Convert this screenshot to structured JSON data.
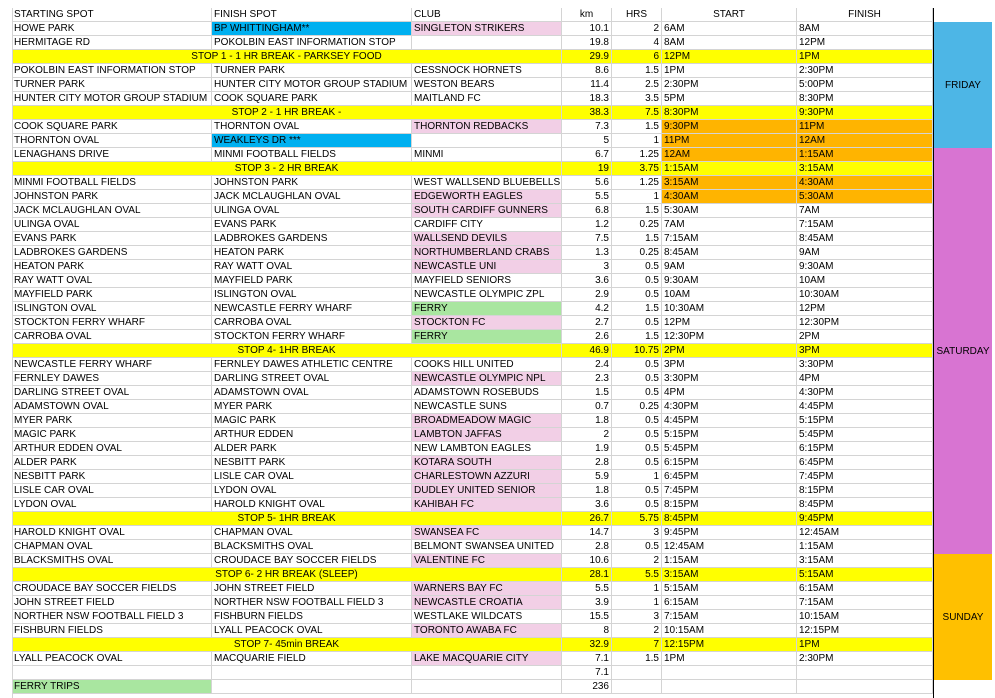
{
  "colors": {
    "yellow": "#ffff00",
    "pink": "#f2cfe6",
    "blue": "#00b0f0",
    "green": "#a9e6a0",
    "orange": "#ffb400",
    "friday": "#4db6e6",
    "saturday": "#d874d2",
    "sunday": "#ffc000"
  },
  "headers": [
    "STARTING SPOT",
    "FINISH SPOT",
    "CLUB",
    "km",
    "HRS",
    "START",
    "FINISH"
  ],
  "rows": [
    {
      "a": "HOWE PARK",
      "b": "BP WHITTINGHAM**",
      "c": "SINGLETON STRIKERS",
      "d": "10.1",
      "e": "2",
      "f": "6AM",
      "g": "8AM",
      "bc": "blue",
      "cc": "pink"
    },
    {
      "a": "HERMITAGE RD",
      "b": "POKOLBIN EAST INFORMATION STOP",
      "c": "",
      "d": "19.8",
      "e": "4",
      "f": "8AM",
      "g": "12PM"
    },
    {
      "stop": "STOP 1 - 1 HR BREAK - PARKSEY FOOD",
      "d": "29.9",
      "e": "6",
      "f": "12PM",
      "g": "1PM"
    },
    {
      "a": "POKOLBIN EAST INFORMATION STOP",
      "b": "TURNER PARK",
      "c": "CESSNOCK HORNETS",
      "d": "8.6",
      "e": "1.5",
      "f": "1PM",
      "g": "2:30PM"
    },
    {
      "a": "TURNER PARK",
      "b": "HUNTER CITY MOTOR GROUP STADIUM",
      "c": "WESTON BEARS",
      "d": "11.4",
      "e": "2.5",
      "f": "2:30PM",
      "g": "5:00PM"
    },
    {
      "a": "HUNTER CITY MOTOR GROUP STADIUM",
      "b": "COOK SQUARE PARK",
      "c": "MAITLAND FC",
      "d": "18.3",
      "e": "3.5",
      "f": "5PM",
      "g": "8:30PM"
    },
    {
      "stop": "STOP 2 - 1 HR BREAK -",
      "d": "38.3",
      "e": "7.5",
      "f": "8:30PM",
      "g": "9:30PM"
    },
    {
      "a": "COOK SQUARE PARK",
      "b": "THORNTON OVAL",
      "c": "THORNTON REDBACKS",
      "d": "7.3",
      "e": "1.5",
      "f": "9:30PM",
      "g": "11PM",
      "cc": "pink",
      "fc": "orange",
      "gc": "orange"
    },
    {
      "a": "THORNTON OVAL",
      "b": "WEAKLEYS DR ***",
      "c": "",
      "d": "5",
      "e": "1",
      "f": "11PM",
      "g": "12AM",
      "bc": "blue",
      "fc": "orange",
      "gc": "orange"
    },
    {
      "a": "LENAGHANS DRIVE",
      "b": "MINMI FOOTBALL FIELDS",
      "c": "MINMI",
      "d": "6.7",
      "e": "1.25",
      "f": "12AM",
      "g": "1:15AM",
      "fc": "orange",
      "gc": "orange"
    },
    {
      "stop": "STOP 3 - 2 HR BREAK",
      "d": "19",
      "e": "3.75",
      "f": "1:15AM",
      "g": "3:15AM"
    },
    {
      "a": "MINMI FOOTBALL FIELDS",
      "b": "JOHNSTON PARK",
      "c": "WEST WALLSEND BLUEBELLS",
      "d": "5.6",
      "e": "1.25",
      "f": "3:15AM",
      "g": "4:30AM",
      "fc": "orange",
      "gc": "orange"
    },
    {
      "a": "JOHNSTON PARK",
      "b": "JACK MCLAUGHLAN OVAL",
      "c": "EDGEWORTH EAGLES",
      "d": "5.5",
      "e": "1",
      "f": "4:30AM",
      "g": "5:30AM",
      "cc": "pink",
      "fc": "orange",
      "gc": "orange"
    },
    {
      "a": "JACK MCLAUGHLAN OVAL",
      "b": "ULINGA OVAL",
      "c": "SOUTH CARDIFF GUNNERS",
      "d": "6.8",
      "e": "1.5",
      "f": "5:30AM",
      "g": "7AM",
      "cc": "pink"
    },
    {
      "a": "ULINGA OVAL",
      "b": "EVANS PARK",
      "c": "CARDIFF CITY",
      "d": "1.2",
      "e": "0.25",
      "f": "7AM",
      "g": "7:15AM"
    },
    {
      "a": "EVANS PARK",
      "b": "LADBROKES GARDENS",
      "c": "WALLSEND DEVILS",
      "d": "7.5",
      "e": "1.5",
      "f": "7:15AM",
      "g": "8:45AM",
      "cc": "pink"
    },
    {
      "a": "LADBROKES GARDENS",
      "b": "HEATON PARK",
      "c": "NORTHUMBERLAND CRABS",
      "d": "1.3",
      "e": "0.25",
      "f": "8:45AM",
      "g": "9AM",
      "cc": "pink"
    },
    {
      "a": "HEATON PARK",
      "b": "RAY WATT OVAL",
      "c": "NEWCASTLE UNI",
      "d": "3",
      "e": "0.5",
      "f": "9AM",
      "g": "9:30AM",
      "cc": "pink"
    },
    {
      "a": "RAY WATT OVAL",
      "b": "MAYFIELD PARK",
      "c": "MAYFIELD SENIORS",
      "d": "3.6",
      "e": "0.5",
      "f": "9:30AM",
      "g": "10AM"
    },
    {
      "a": "MAYFIELD PARK",
      "b": "ISLINGTON OVAL",
      "c": "NEWCASTLE OLYMPIC ZPL",
      "d": "2.9",
      "e": "0.5",
      "f": "10AM",
      "g": "10:30AM"
    },
    {
      "a": "ISLINGTON OVAL",
      "b": "NEWCASTLE FERRY WHARF",
      "c": "FERRY",
      "d": "4.2",
      "e": "1.5",
      "f": "10:30AM",
      "g": "12PM",
      "cc": "green"
    },
    {
      "a": "STOCKTON FERRY WHARF",
      "b": "CARROBA OVAL",
      "c": "STOCKTON FC",
      "d": "2.7",
      "e": "0.5",
      "f": "12PM",
      "g": "12:30PM",
      "cc": "pink"
    },
    {
      "a": "CARROBA OVAL",
      "b": "STOCKTON FERRY WHARF",
      "c": "FERRY",
      "d": "2.6",
      "e": "1.5",
      "f": "12:30PM",
      "g": "2PM",
      "cc": "green"
    },
    {
      "stop": "STOP 4- 1HR BREAK",
      "d": "46.9",
      "e": "10.75",
      "f": "2PM",
      "g": "3PM"
    },
    {
      "a": "NEWCASTLE FERRY WHARF",
      "b": "FERNLEY DAWES ATHLETIC CENTRE",
      "c": "COOKS HILL UNITED",
      "d": "2.4",
      "e": "0.5",
      "f": "3PM",
      "g": "3:30PM"
    },
    {
      "a": "FERNLEY DAWES",
      "b": "DARLING STREET OVAL",
      "c": "NEWCASTLE OLYMPIC NPL",
      "d": "2.3",
      "e": "0.5",
      "f": "3:30PM",
      "g": "4PM",
      "cc": "pink"
    },
    {
      "a": "DARLING STREET OVAL",
      "b": "ADAMSTOWN OVAL",
      "c": "ADAMSTOWN ROSEBUDS",
      "d": "1.5",
      "e": "0.5",
      "f": "4PM",
      "g": "4:30PM"
    },
    {
      "a": "ADAMSTOWN OVAL",
      "b": "MYER PARK",
      "c": "NEWCASTLE SUNS",
      "d": "0.7",
      "e": "0.25",
      "f": "4:30PM",
      "g": "4:45PM"
    },
    {
      "a": "MYER PARK",
      "b": "MAGIC PARK",
      "c": "BROADMEADOW MAGIC",
      "d": "1.8",
      "e": "0.5",
      "f": "4:45PM",
      "g": "5:15PM",
      "cc": "pink"
    },
    {
      "a": "MAGIC PARK",
      "b": "ARTHUR EDDEN",
      "c": "LAMBTON JAFFAS",
      "d": "2",
      "e": "0.5",
      "f": "5:15PM",
      "g": "5:45PM",
      "cc": "pink"
    },
    {
      "a": "ARTHUR EDDEN OVAL",
      "b": "ALDER PARK",
      "c": "NEW LAMBTON EAGLES",
      "d": "1.9",
      "e": "0.5",
      "f": "5:45PM",
      "g": "6:15PM"
    },
    {
      "a": "ALDER PARK",
      "b": "NESBITT PARK",
      "c": "KOTARA SOUTH",
      "d": "2.8",
      "e": "0.5",
      "f": "6:15PM",
      "g": "6:45PM",
      "cc": "pink"
    },
    {
      "a": "NESBITT PARK",
      "b": "LISLE CAR OVAL",
      "c": "CHARLESTOWN AZZURI",
      "d": "5.9",
      "e": "1",
      "f": "6:45PM",
      "g": "7:45PM",
      "cc": "pink"
    },
    {
      "a": "LISLE CAR OVAL",
      "b": "LYDON OVAL",
      "c": "DUDLEY UNITED SENIOR",
      "d": "1.8",
      "e": "0.5",
      "f": "7:45PM",
      "g": "8:15PM",
      "cc": "pink"
    },
    {
      "a": "LYDON OVAL",
      "b": "HAROLD KNIGHT OVAL",
      "c": "KAHIBAH FC",
      "d": "3.6",
      "e": "0.5",
      "f": "8:15PM",
      "g": "8:45PM",
      "cc": "pink"
    },
    {
      "stop": "STOP 5- 1HR BREAK",
      "d": "26.7",
      "e": "5.75",
      "f": "8:45PM",
      "g": "9:45PM"
    },
    {
      "a": "HAROLD KNIGHT OVAL",
      "b": "CHAPMAN OVAL",
      "c": "SWANSEA FC",
      "d": "14.7",
      "e": "3",
      "f": "9:45PM",
      "g": "12:45AM",
      "cc": "pink"
    },
    {
      "a": "CHAPMAN OVAL",
      "b": "BLACKSMITHS OVAL",
      "c": "BELMONT SWANSEA UNITED",
      "d": "2.8",
      "e": "0.5",
      "f": "12:45AM",
      "g": "1:15AM"
    },
    {
      "a": "BLACKSMITHS OVAL",
      "b": "CROUDACE BAY SOCCER FIELDS",
      "c": "VALENTINE FC",
      "d": "10.6",
      "e": "2",
      "f": "1:15AM",
      "g": "3:15AM",
      "cc": "pink"
    },
    {
      "stop": "STOP 6- 2 HR BREAK (SLEEP)",
      "d": "28.1",
      "e": "5.5",
      "f": "3:15AM",
      "g": "5:15AM"
    },
    {
      "a": "CROUDACE BAY SOCCER FIELDS",
      "b": "JOHN STREET FIELD",
      "c": "WARNERS BAY FC",
      "d": "5.5",
      "e": "1",
      "f": "5:15AM",
      "g": "6:15AM",
      "cc": "pink"
    },
    {
      "a": "JOHN STREET FIELD",
      "b": "NORTHER NSW FOOTBALL FIELD 3",
      "c": "NEWCASTLE CROATIA",
      "d": "3.9",
      "e": "1",
      "f": "6:15AM",
      "g": "7:15AM",
      "cc": "pink"
    },
    {
      "a": "NORTHER NSW FOOTBALL FIELD 3",
      "b": "FISHBURN FIELDS",
      "c": "WESTLAKE WILDCATS",
      "d": "15.5",
      "e": "3",
      "f": "7:15AM",
      "g": "10:15AM"
    },
    {
      "a": "FISHBURN FIELDS",
      "b": "LYALL PEACOCK OVAL",
      "c": "TORONTO AWABA FC",
      "d": "8",
      "e": "2",
      "f": "10:15AM",
      "g": "12:15PM",
      "cc": "pink"
    },
    {
      "stop": "STOP 7- 45min BREAK",
      "d": "32.9",
      "e": "7",
      "f": "12:15PM",
      "g": "1PM"
    },
    {
      "a": "LYALL PEACOCK OVAL",
      "b": "MACQUARIE FIELD",
      "c": "LAKE MACQUARIE CITY",
      "d": "7.1",
      "e": "1.5",
      "f": "1PM",
      "g": "2:30PM",
      "cc": "pink"
    },
    {
      "a": "",
      "b": "",
      "c": "",
      "d": "7.1",
      "e": "",
      "f": "",
      "g": ""
    },
    {
      "a": "FERRY TRIPS",
      "b": "",
      "c": "",
      "d": "236",
      "e": "",
      "f": "",
      "g": "",
      "ac": "green"
    }
  ],
  "days": [
    {
      "label": "FRIDAY",
      "color": "friday",
      "from": 0,
      "to": 9
    },
    {
      "label": "SATURDAY",
      "color": "saturday",
      "from": 9,
      "to": 38
    },
    {
      "label": "SUNDAY",
      "color": "sunday",
      "from": 38,
      "to": 47
    }
  ]
}
